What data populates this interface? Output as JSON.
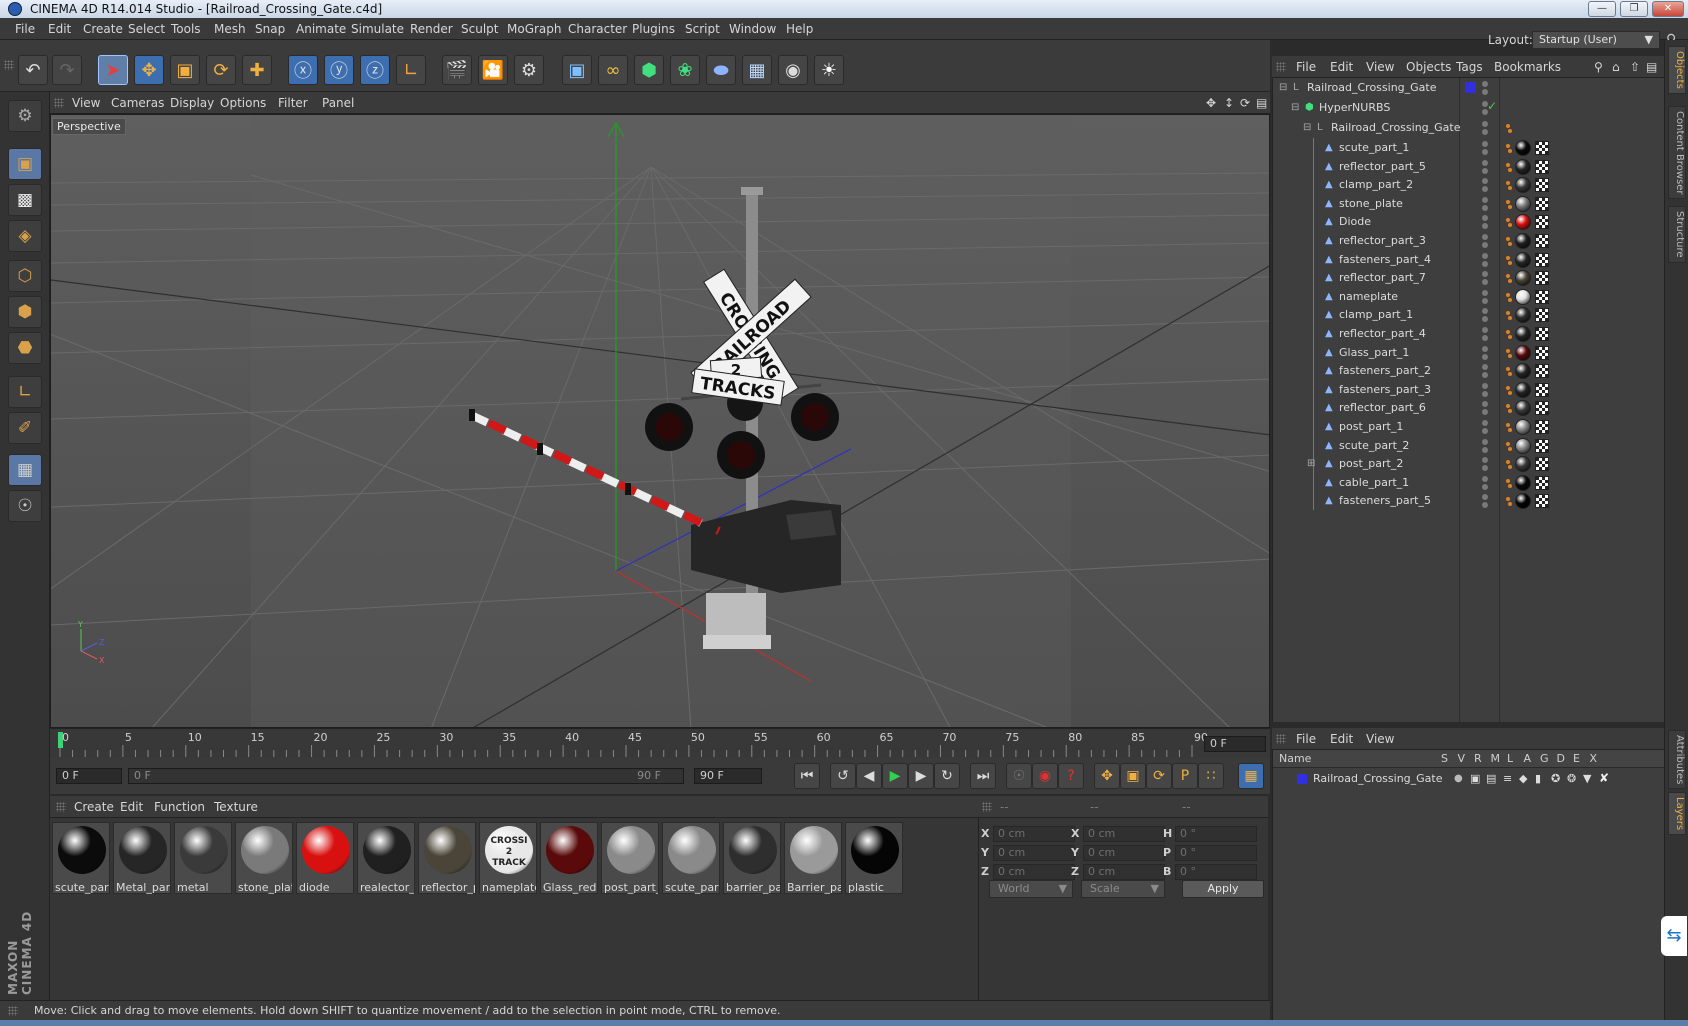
{
  "window": {
    "title": "CINEMA 4D R14.014 Studio - [Railroad_Crossing_Gate.c4d]"
  },
  "menu": [
    "File",
    "Edit",
    "Create",
    "Select",
    "Tools",
    "Mesh",
    "Snap",
    "Animate",
    "Simulate",
    "Render",
    "Sculpt",
    "MoGraph",
    "Character",
    "Plugins",
    "Script",
    "Window",
    "Help"
  ],
  "layout": {
    "label": "Layout:",
    "value": "Startup (User)"
  },
  "viewport": {
    "menu": [
      "View",
      "Cameras",
      "Display",
      "Options",
      "Filter",
      "Panel"
    ],
    "label": "Perspective",
    "sign_lines": [
      "CROSSING",
      "RAILROAD",
      "2",
      "TRACKS"
    ]
  },
  "timeline": {
    "ticks": [
      "0",
      "5",
      "10",
      "15",
      "20",
      "25",
      "30",
      "35",
      "40",
      "45",
      "50",
      "55",
      "60",
      "65",
      "70",
      "75",
      "80",
      "85",
      "90"
    ],
    "current_frame": "0 F",
    "start": "0 F",
    "range_start": "0 F",
    "range_end": "90 F",
    "end": "90 F"
  },
  "materials": {
    "menu": [
      "Create",
      "Edit",
      "Function",
      "Texture"
    ],
    "items": [
      {
        "name": "scute_part_",
        "color": "#0b0b0b"
      },
      {
        "name": "Metal_part",
        "color": "#262626"
      },
      {
        "name": "metal",
        "color": "#3a3a3a"
      },
      {
        "name": "stone_plate",
        "color": "#7a7a7a"
      },
      {
        "name": "diode",
        "color": "#d81010"
      },
      {
        "name": "realector_p",
        "color": "#202020"
      },
      {
        "name": "reflector_p",
        "color": "#4a4538"
      },
      {
        "name": "nameplate",
        "color": "#e8e8e8"
      },
      {
        "name": "Glass_red",
        "color": "#5a0a0a"
      },
      {
        "name": "post_part_",
        "color": "#8a8a8a"
      },
      {
        "name": "scute_part",
        "color": "#8a8a8a"
      },
      {
        "name": "barrier_par",
        "color": "#2e2e2e"
      },
      {
        "name": "Barrier_par",
        "color": "#9a9a9a"
      },
      {
        "name": "plastic",
        "color": "#050505"
      }
    ],
    "nameplate_text": [
      "CROSSI",
      "2",
      "TRACK"
    ]
  },
  "coordinates": {
    "header": [
      "--",
      "--",
      "--"
    ],
    "rows": [
      {
        "a": "X",
        "av": "0 cm",
        "b": "X",
        "bv": "0 cm",
        "c": "H",
        "cv": "0 °"
      },
      {
        "a": "Y",
        "av": "0 cm",
        "b": "Y",
        "bv": "0 cm",
        "c": "P",
        "cv": "0 °"
      },
      {
        "a": "Z",
        "av": "0 cm",
        "b": "Z",
        "bv": "0 cm",
        "c": "B",
        "cv": "0 °"
      }
    ],
    "world": "World",
    "scale": "Scale",
    "apply": "Apply"
  },
  "objects": {
    "menu": [
      "File",
      "Edit",
      "View",
      "Objects",
      "Tags",
      "Bookmarks"
    ],
    "root": "Railroad_Crossing_Gate",
    "hypernurbs": "HyperNURBS",
    "group": "Railroad_Crossing_Gate",
    "children": [
      {
        "name": "scute_part_1",
        "color": "#0a0a0a"
      },
      {
        "name": "reflector_part_5",
        "color": "#262626"
      },
      {
        "name": "clamp_part_2",
        "color": "#3a3a3a"
      },
      {
        "name": "stone_plate",
        "color": "#7a7a7a"
      },
      {
        "name": "Diode",
        "color": "#d81010"
      },
      {
        "name": "reflector_part_3",
        "color": "#202020"
      },
      {
        "name": "fasteners_part_4",
        "color": "#262626"
      },
      {
        "name": "reflector_part_7",
        "color": "#4a4538"
      },
      {
        "name": "nameplate",
        "color": "#e0e0e0"
      },
      {
        "name": "clamp_part_1",
        "color": "#2e2e2e"
      },
      {
        "name": "reflector_part_4",
        "color": "#262626"
      },
      {
        "name": "Glass_part_1",
        "color": "#5a0a0a"
      },
      {
        "name": "fasteners_part_2",
        "color": "#262626"
      },
      {
        "name": "fasteners_part_3",
        "color": "#262626"
      },
      {
        "name": "reflector_part_6",
        "color": "#3a3a3a"
      },
      {
        "name": "post_part_1",
        "color": "#8a8a8a"
      },
      {
        "name": "scute_part_2",
        "color": "#8a8a8a"
      },
      {
        "name": "post_part_2",
        "color": "#3a3a3a"
      },
      {
        "name": "cable_part_1",
        "color": "#080808"
      },
      {
        "name": "fasteners_part_5",
        "color": "#050505"
      }
    ]
  },
  "layers": {
    "menu": [
      "File",
      "Edit",
      "View"
    ],
    "columns": [
      "Name",
      "S",
      "V",
      "R",
      "M",
      "L",
      "A",
      "G",
      "D",
      "E",
      "X"
    ],
    "items": [
      {
        "name": "Railroad_Crossing_Gate",
        "color": "#3030e0"
      }
    ]
  },
  "right_tabs": [
    "Objects",
    "Content Browser",
    "Structure",
    "Attributes",
    "Layers"
  ],
  "status": "Move: Click and drag to move elements. Hold down SHIFT to quantize movement / add to the selection in point mode, CTRL to remove.",
  "brand": "MAXON CINEMA 4D",
  "colors": {
    "accent": "#5a78a3",
    "diode": "#d81010",
    "layer": "#3030e0"
  }
}
